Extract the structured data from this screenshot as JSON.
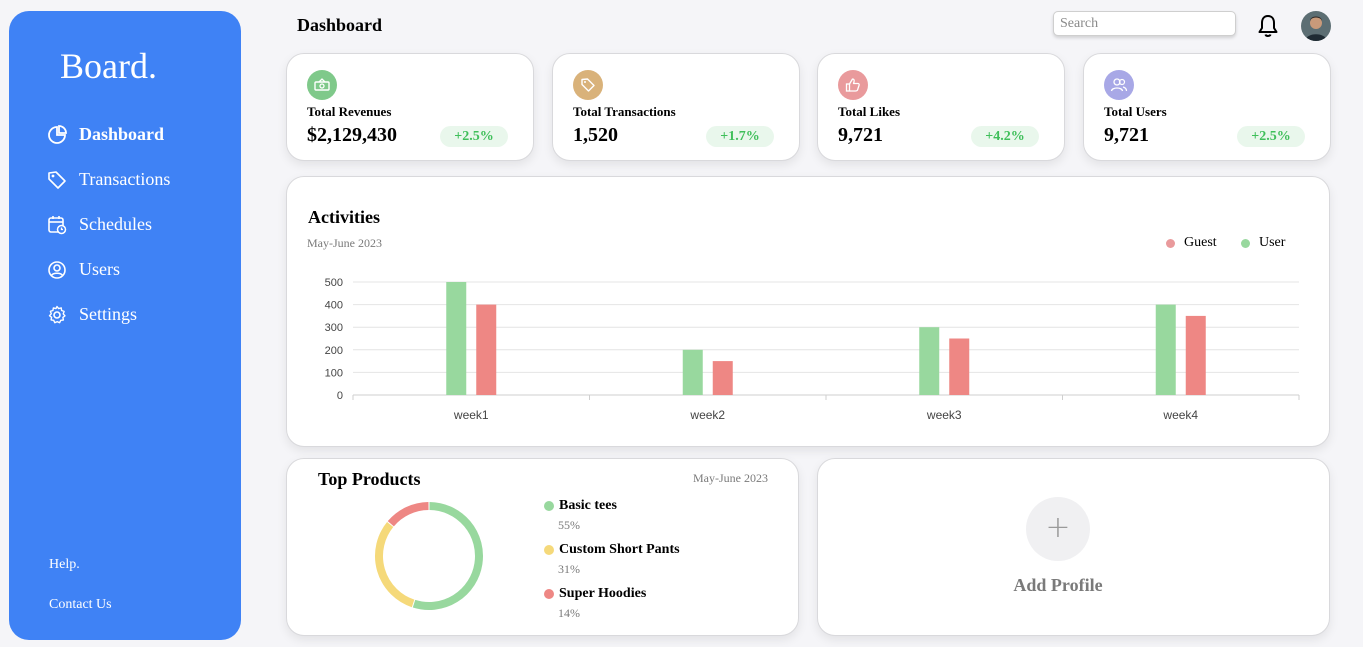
{
  "brand": "Board.",
  "nav": [
    {
      "label": "Dashboard",
      "icon": "pie-chart-icon",
      "active": true
    },
    {
      "label": "Transactions",
      "icon": "tag-icon",
      "active": false
    },
    {
      "label": "Schedules",
      "icon": "calendar-clock-icon",
      "active": false
    },
    {
      "label": "Users",
      "icon": "user-circle-icon",
      "active": false
    },
    {
      "label": "Settings",
      "icon": "gear-icon",
      "active": false
    }
  ],
  "footer": {
    "help": "Help.",
    "contact": "Contact Us"
  },
  "header": {
    "title": "Dashboard",
    "search_placeholder": "Search"
  },
  "stats": [
    {
      "label": "Total Revenues",
      "value": "$2,129,430",
      "change": "+2.5%",
      "icon": "money-icon",
      "color": "#7fc98a"
    },
    {
      "label": "Total Transactions",
      "value": "1,520",
      "change": "+1.7%",
      "icon": "tag-icon",
      "color": "#d9b27a"
    },
    {
      "label": "Total Likes",
      "value": "9,721",
      "change": "+4.2%",
      "icon": "thumbs-up-icon",
      "color": "#e99a9c"
    },
    {
      "label": "Total Users",
      "value": "9,721",
      "change": "+2.5%",
      "icon": "users-icon",
      "color": "#a8a8e6"
    }
  ],
  "activities": {
    "title": "Activities",
    "subtitle": "May-June 2023",
    "legend": [
      {
        "name": "Guest",
        "color": "#e99a9c"
      },
      {
        "name": "User",
        "color": "#98d89e"
      }
    ]
  },
  "chart_data": {
    "type": "bar",
    "categories": [
      "week1",
      "week2",
      "week3",
      "week4"
    ],
    "series": [
      {
        "name": "User",
        "color": "#98d89e",
        "values": [
          500,
          200,
          300,
          400
        ]
      },
      {
        "name": "Guest",
        "color": "#ee8784",
        "values": [
          400,
          150,
          250,
          350
        ]
      }
    ],
    "ylim": [
      0,
      500
    ],
    "yticks": [
      0,
      100,
      200,
      300,
      400,
      500
    ],
    "grid": true,
    "legend_position": "top-right"
  },
  "top_products": {
    "title": "Top Products",
    "date": "May-June 2023",
    "items": [
      {
        "name": "Basic tees",
        "pct": "55%",
        "value": 55,
        "color": "#98d89e"
      },
      {
        "name": "Custom Short Pants",
        "pct": "31%",
        "value": 31,
        "color": "#f5d97a"
      },
      {
        "name": "Super Hoodies",
        "pct": "14%",
        "value": 14,
        "color": "#ee8784"
      }
    ]
  },
  "add_profile": {
    "label": "Add Profile",
    "plus": "+"
  }
}
